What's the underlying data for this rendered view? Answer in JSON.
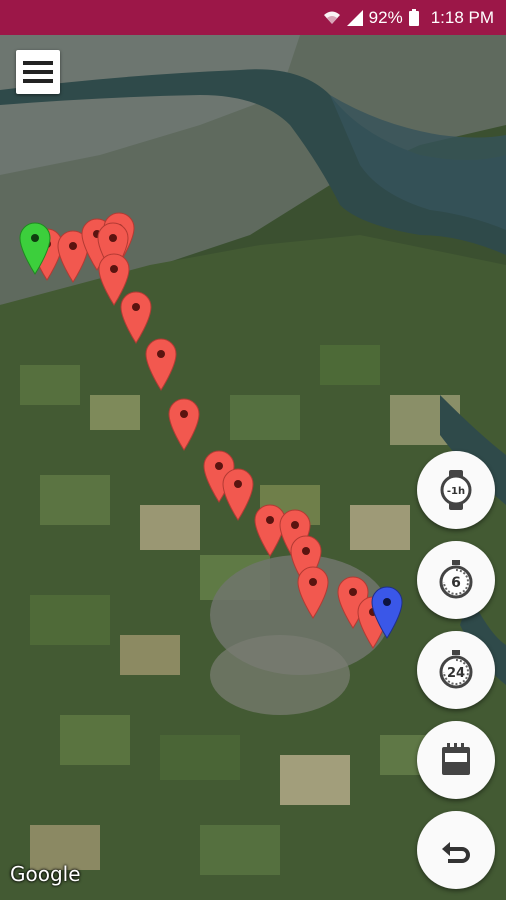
{
  "status_bar": {
    "battery_percent": "92%",
    "time": "1:18 PM",
    "icons": [
      "wifi-icon",
      "signal-icon",
      "battery-icon"
    ],
    "background": "#9c1748"
  },
  "map": {
    "attribution": "Google",
    "type": "satellite",
    "start_marker_color": "#3ccf3c",
    "track_marker_color": "#f2584f",
    "end_marker_color": "#3a57e8",
    "water_color": "#2f4a4a"
  },
  "menu": {
    "icon": "hamburger-menu-icon"
  },
  "actions": [
    {
      "id": "minus-1h",
      "icon": "watch-icon",
      "label": "-1h"
    },
    {
      "id": "last-6",
      "icon": "stopwatch-icon",
      "label": "6"
    },
    {
      "id": "last-24",
      "icon": "clock-24h-icon",
      "label": "24"
    },
    {
      "id": "calendar",
      "icon": "calendar-icon",
      "label": ""
    },
    {
      "id": "back",
      "icon": "undo-arrow-icon",
      "label": ""
    }
  ]
}
